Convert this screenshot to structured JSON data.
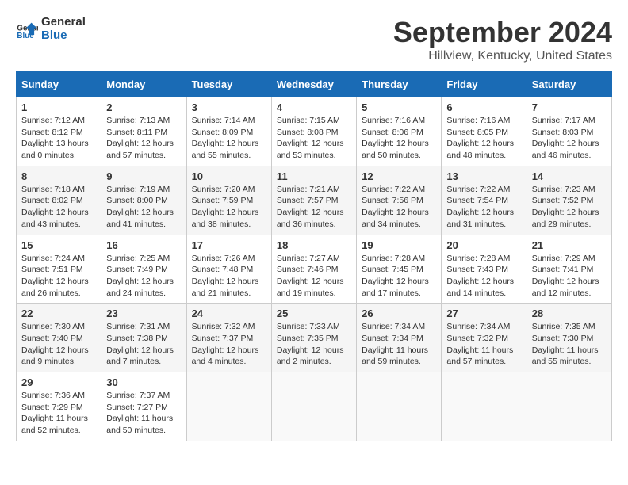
{
  "logo": {
    "general": "General",
    "blue": "Blue"
  },
  "title": "September 2024",
  "subtitle": "Hillview, Kentucky, United States",
  "headers": [
    "Sunday",
    "Monday",
    "Tuesday",
    "Wednesday",
    "Thursday",
    "Friday",
    "Saturday"
  ],
  "weeks": [
    [
      {
        "day": "1",
        "info": "Sunrise: 7:12 AM\nSunset: 8:12 PM\nDaylight: 13 hours\nand 0 minutes."
      },
      {
        "day": "2",
        "info": "Sunrise: 7:13 AM\nSunset: 8:11 PM\nDaylight: 12 hours\nand 57 minutes."
      },
      {
        "day": "3",
        "info": "Sunrise: 7:14 AM\nSunset: 8:09 PM\nDaylight: 12 hours\nand 55 minutes."
      },
      {
        "day": "4",
        "info": "Sunrise: 7:15 AM\nSunset: 8:08 PM\nDaylight: 12 hours\nand 53 minutes."
      },
      {
        "day": "5",
        "info": "Sunrise: 7:16 AM\nSunset: 8:06 PM\nDaylight: 12 hours\nand 50 minutes."
      },
      {
        "day": "6",
        "info": "Sunrise: 7:16 AM\nSunset: 8:05 PM\nDaylight: 12 hours\nand 48 minutes."
      },
      {
        "day": "7",
        "info": "Sunrise: 7:17 AM\nSunset: 8:03 PM\nDaylight: 12 hours\nand 46 minutes."
      }
    ],
    [
      {
        "day": "8",
        "info": "Sunrise: 7:18 AM\nSunset: 8:02 PM\nDaylight: 12 hours\nand 43 minutes."
      },
      {
        "day": "9",
        "info": "Sunrise: 7:19 AM\nSunset: 8:00 PM\nDaylight: 12 hours\nand 41 minutes."
      },
      {
        "day": "10",
        "info": "Sunrise: 7:20 AM\nSunset: 7:59 PM\nDaylight: 12 hours\nand 38 minutes."
      },
      {
        "day": "11",
        "info": "Sunrise: 7:21 AM\nSunset: 7:57 PM\nDaylight: 12 hours\nand 36 minutes."
      },
      {
        "day": "12",
        "info": "Sunrise: 7:22 AM\nSunset: 7:56 PM\nDaylight: 12 hours\nand 34 minutes."
      },
      {
        "day": "13",
        "info": "Sunrise: 7:22 AM\nSunset: 7:54 PM\nDaylight: 12 hours\nand 31 minutes."
      },
      {
        "day": "14",
        "info": "Sunrise: 7:23 AM\nSunset: 7:52 PM\nDaylight: 12 hours\nand 29 minutes."
      }
    ],
    [
      {
        "day": "15",
        "info": "Sunrise: 7:24 AM\nSunset: 7:51 PM\nDaylight: 12 hours\nand 26 minutes."
      },
      {
        "day": "16",
        "info": "Sunrise: 7:25 AM\nSunset: 7:49 PM\nDaylight: 12 hours\nand 24 minutes."
      },
      {
        "day": "17",
        "info": "Sunrise: 7:26 AM\nSunset: 7:48 PM\nDaylight: 12 hours\nand 21 minutes."
      },
      {
        "day": "18",
        "info": "Sunrise: 7:27 AM\nSunset: 7:46 PM\nDaylight: 12 hours\nand 19 minutes."
      },
      {
        "day": "19",
        "info": "Sunrise: 7:28 AM\nSunset: 7:45 PM\nDaylight: 12 hours\nand 17 minutes."
      },
      {
        "day": "20",
        "info": "Sunrise: 7:28 AM\nSunset: 7:43 PM\nDaylight: 12 hours\nand 14 minutes."
      },
      {
        "day": "21",
        "info": "Sunrise: 7:29 AM\nSunset: 7:41 PM\nDaylight: 12 hours\nand 12 minutes."
      }
    ],
    [
      {
        "day": "22",
        "info": "Sunrise: 7:30 AM\nSunset: 7:40 PM\nDaylight: 12 hours\nand 9 minutes."
      },
      {
        "day": "23",
        "info": "Sunrise: 7:31 AM\nSunset: 7:38 PM\nDaylight: 12 hours\nand 7 minutes."
      },
      {
        "day": "24",
        "info": "Sunrise: 7:32 AM\nSunset: 7:37 PM\nDaylight: 12 hours\nand 4 minutes."
      },
      {
        "day": "25",
        "info": "Sunrise: 7:33 AM\nSunset: 7:35 PM\nDaylight: 12 hours\nand 2 minutes."
      },
      {
        "day": "26",
        "info": "Sunrise: 7:34 AM\nSunset: 7:34 PM\nDaylight: 11 hours\nand 59 minutes."
      },
      {
        "day": "27",
        "info": "Sunrise: 7:34 AM\nSunset: 7:32 PM\nDaylight: 11 hours\nand 57 minutes."
      },
      {
        "day": "28",
        "info": "Sunrise: 7:35 AM\nSunset: 7:30 PM\nDaylight: 11 hours\nand 55 minutes."
      }
    ],
    [
      {
        "day": "29",
        "info": "Sunrise: 7:36 AM\nSunset: 7:29 PM\nDaylight: 11 hours\nand 52 minutes."
      },
      {
        "day": "30",
        "info": "Sunrise: 7:37 AM\nSunset: 7:27 PM\nDaylight: 11 hours\nand 50 minutes."
      },
      {
        "day": "",
        "info": ""
      },
      {
        "day": "",
        "info": ""
      },
      {
        "day": "",
        "info": ""
      },
      {
        "day": "",
        "info": ""
      },
      {
        "day": "",
        "info": ""
      }
    ]
  ]
}
